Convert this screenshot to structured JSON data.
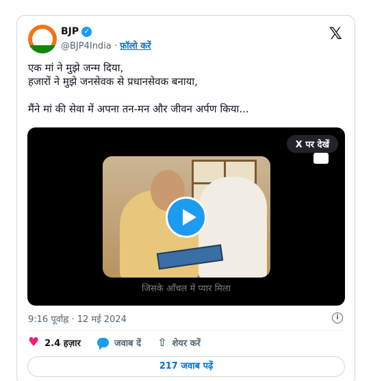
{
  "author": {
    "name": "BJP",
    "handle": "@BJP4India",
    "separator": "·",
    "follow_label": "फ़ॉलो करें"
  },
  "tweet": {
    "line1": "एक मां ने मुझे जन्म दिया,",
    "line2": "हजारों ने मुझे जनसेवक से प्रधानसेवक बनाया,",
    "line3": "मैंने मां की सेवा में अपना तन-मन और जीवन अर्पण किया..."
  },
  "media": {
    "see_on_x_label": "X पर देखें",
    "caption": "जिसके आँचल में प्यार मिला"
  },
  "meta": {
    "timestamp": "9:16 पूर्वाह्न · 12 मई 2024"
  },
  "actions": {
    "likes": "2.4 हज़ार",
    "reply_label": "जवाब दें",
    "share_label": "शेयर करें"
  },
  "footer": {
    "read_replies_label": "217 जवाब पढ़ें"
  },
  "colors": {
    "accent": "#1d9bf0",
    "like": "#f91880",
    "link": "#006fd6"
  }
}
